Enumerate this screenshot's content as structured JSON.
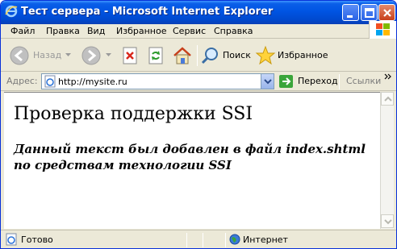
{
  "window": {
    "title": "Тест сервера - Microsoft Internet Explorer"
  },
  "menu": {
    "items": [
      "Файл",
      "Правка",
      "Вид",
      "Избранное",
      "Сервис",
      "Справка"
    ]
  },
  "toolbar": {
    "back_label": "Назад",
    "search_label": "Поиск",
    "favorites_label": "Избранное"
  },
  "address": {
    "label": "Адрес:",
    "url": "http://mysite.ru",
    "go_label": "Переход",
    "links_label": "Ссылки"
  },
  "page": {
    "heading": "Проверка поддержки SSI",
    "text": "Данный текст был добавлен в файл index.shtml по средствам технологии SSI"
  },
  "status": {
    "text": "Готово",
    "zone": "Интернет"
  },
  "colors": {
    "titlebar": "#0054e3",
    "chrome": "#ece9d8"
  }
}
